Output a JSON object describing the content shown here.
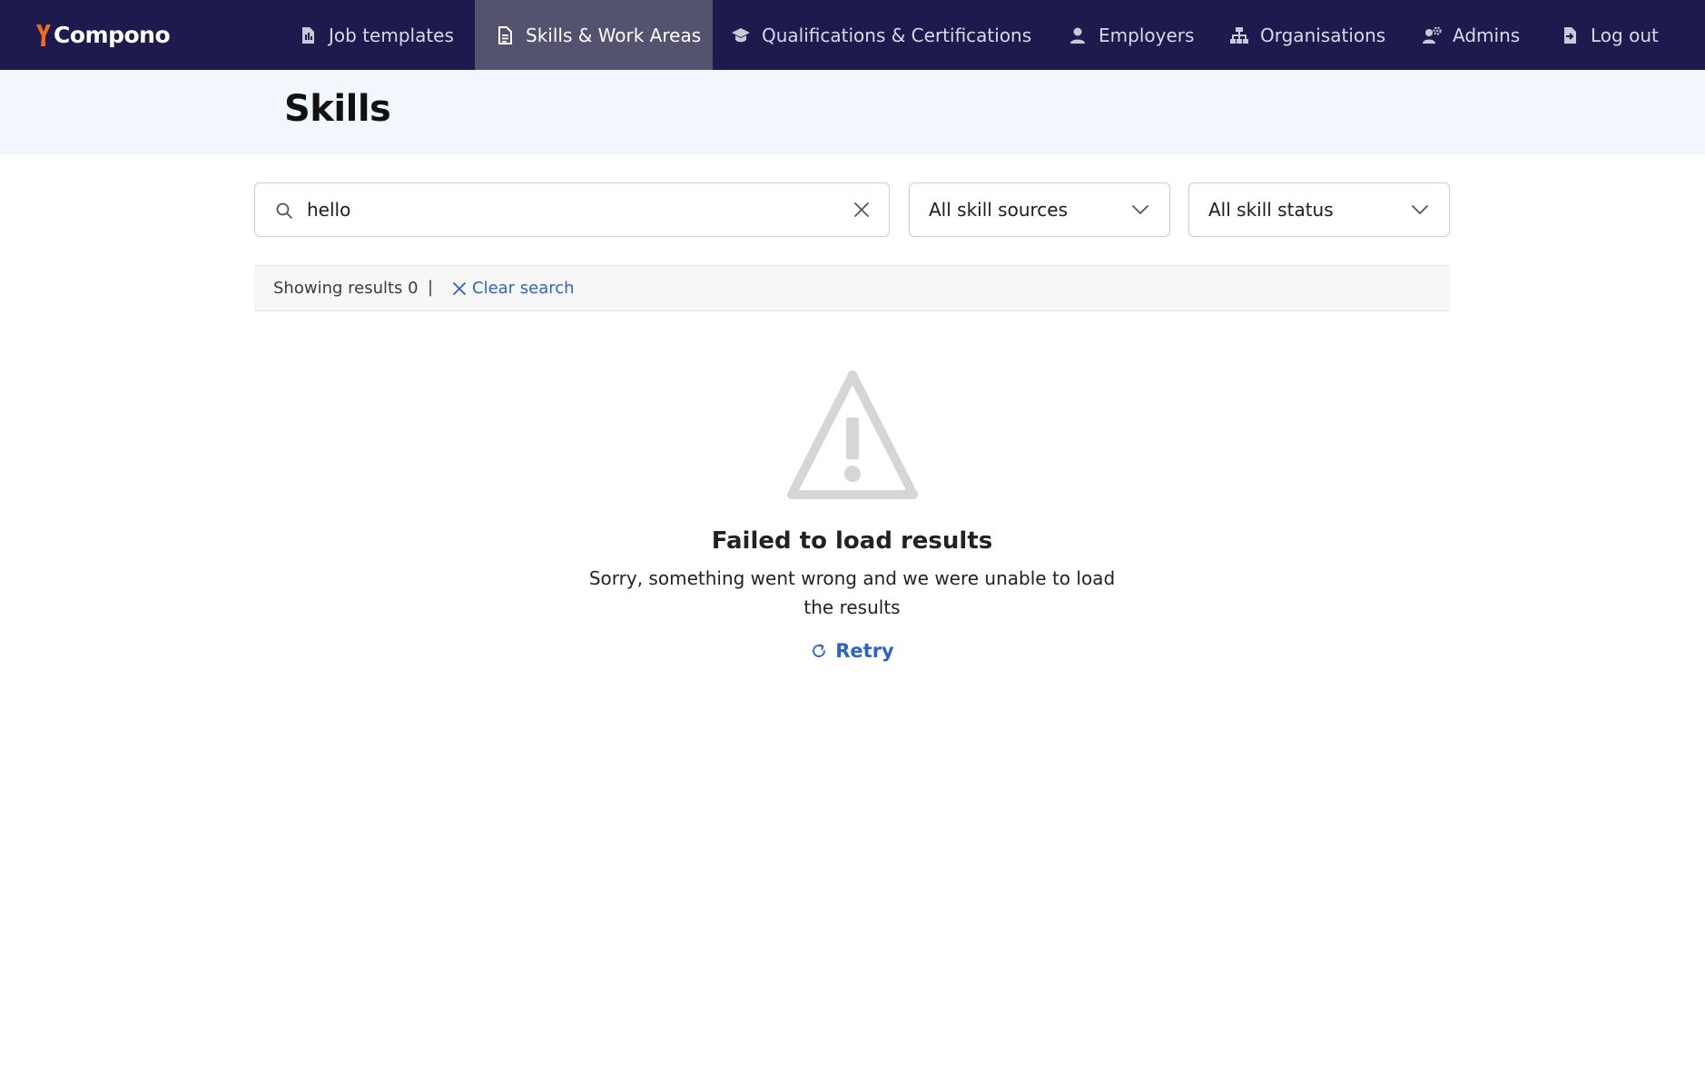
{
  "brand": {
    "name": "Compono",
    "accent_color": "#f26b1d"
  },
  "nav": {
    "background_color": "#1d1b4d",
    "items": [
      {
        "label": "Job templates",
        "icon": "document-icon",
        "active": false
      },
      {
        "label": "Skills & Work Areas",
        "icon": "document-list-icon",
        "active": true
      },
      {
        "label": "Qualifications & Certifications",
        "icon": "graduation-cap-icon",
        "active": false
      },
      {
        "label": "Employers",
        "icon": "user-icon",
        "active": false
      },
      {
        "label": "Organisations",
        "icon": "org-chart-icon",
        "active": false
      },
      {
        "label": "Admins",
        "icon": "user-gear-icon",
        "active": false
      },
      {
        "label": "Log out",
        "icon": "logout-icon",
        "active": false
      }
    ]
  },
  "page": {
    "title": "Skills"
  },
  "filters": {
    "search": {
      "value": "hello",
      "icon": "search-icon"
    },
    "skill_sources": {
      "selected": "All skill sources"
    },
    "skill_status": {
      "selected": "All skill status"
    }
  },
  "results": {
    "showing_text": "Showing results 0",
    "separator": "|",
    "clear_search_label": "Clear search",
    "link_color": "#2b63c9"
  },
  "error": {
    "icon": "warning-icon",
    "title": "Failed to load results",
    "message": "Sorry, something went wrong and we were unable to load the results",
    "retry_label": "Retry"
  }
}
